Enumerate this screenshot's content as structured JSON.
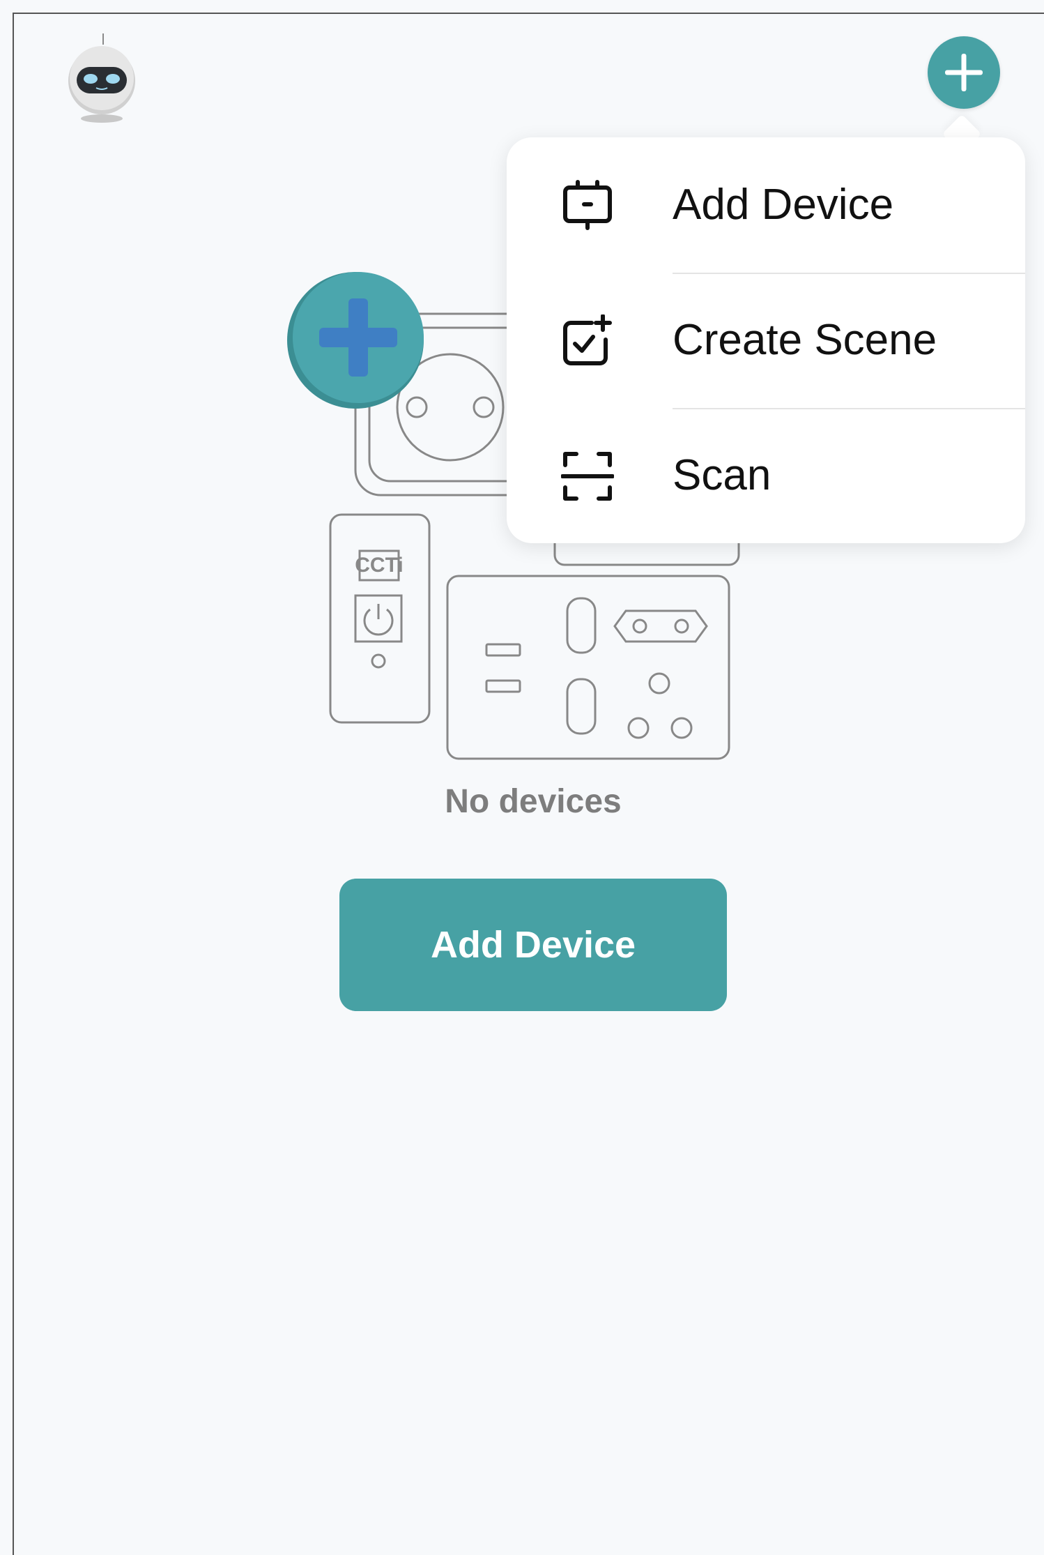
{
  "header": {
    "avatar_icon": "robot-avatar-icon",
    "add_button_icon": "plus-icon"
  },
  "menu": {
    "items": [
      {
        "label": "Add Device",
        "icon": "device-icon"
      },
      {
        "label": "Create Scene",
        "icon": "scene-add-icon"
      },
      {
        "label": "Scan",
        "icon": "scan-icon"
      }
    ]
  },
  "empty_state": {
    "illustration_icon": "devices-illustration",
    "message": "No devices",
    "illustration_badge_text": "CCTi"
  },
  "actions": {
    "add_device_label": "Add Device"
  },
  "colors": {
    "accent": "#47a1a4",
    "background": "#f7f9fb",
    "muted_text": "#7d7d7d",
    "illustration_stroke": "#888888",
    "badge_blue": "#3f7fc4"
  }
}
